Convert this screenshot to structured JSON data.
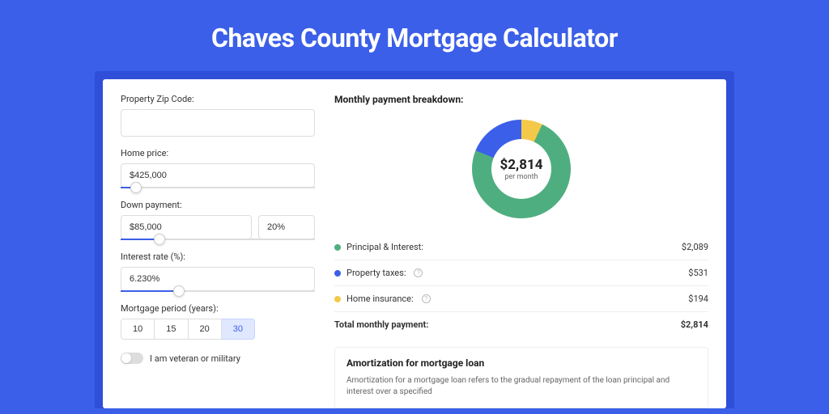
{
  "page_title": "Chaves County Mortgage Calculator",
  "colors": {
    "brand": "#3b5fe8",
    "green": "#4fae7f",
    "yellow": "#f4c94a"
  },
  "form": {
    "zip": {
      "label": "Property Zip Code:",
      "value": ""
    },
    "home_price": {
      "label": "Home price:",
      "value": "$425,000",
      "slider_pct": 8
    },
    "down_payment": {
      "label": "Down payment:",
      "value": "$85,000",
      "pct_value": "20%",
      "slider_pct": 20
    },
    "interest_rate": {
      "label": "Interest rate (%):",
      "value": "6.230%",
      "slider_pct": 30
    },
    "mortgage_period": {
      "label": "Mortgage period (years):",
      "options": [
        "10",
        "15",
        "20",
        "30"
      ],
      "selected": "30"
    },
    "veteran": {
      "label": "I am veteran or military",
      "value": false
    }
  },
  "breakdown": {
    "title": "Monthly payment breakdown:",
    "center_value": "$2,814",
    "center_sub": "per month",
    "items": [
      {
        "label": "Principal & Interest:",
        "value": "$2,089",
        "color": "green",
        "info": false
      },
      {
        "label": "Property taxes:",
        "value": "$531",
        "color": "blue",
        "info": true
      },
      {
        "label": "Home insurance:",
        "value": "$194",
        "color": "yellow",
        "info": true
      }
    ],
    "total": {
      "label": "Total monthly payment:",
      "value": "$2,814"
    }
  },
  "chart_data": {
    "type": "pie",
    "title": "Monthly payment breakdown",
    "series": [
      {
        "name": "Principal & Interest",
        "value": 2089,
        "color": "#4fae7f"
      },
      {
        "name": "Property taxes",
        "value": 531,
        "color": "#3b5fe8"
      },
      {
        "name": "Home insurance",
        "value": 194,
        "color": "#f4c94a"
      }
    ],
    "total": 2814,
    "center_label": "$2,814 per month"
  },
  "amortization": {
    "title": "Amortization for mortgage loan",
    "text": "Amortization for a mortgage loan refers to the gradual repayment of the loan principal and interest over a specified"
  }
}
